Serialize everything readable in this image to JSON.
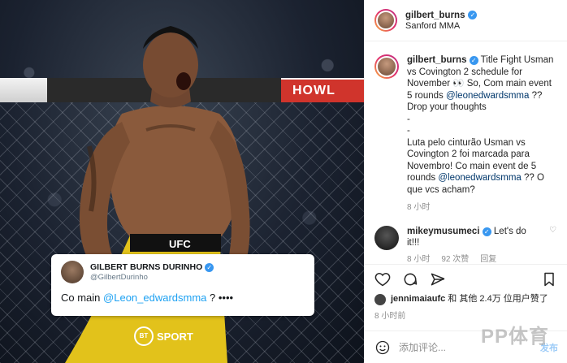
{
  "photo": {
    "banner_text": "HOWL",
    "tweet": {
      "name": "GILBERT BURNS DURINHO",
      "handle": "@GilbertDurinho",
      "text_prefix": "Co main ",
      "mention": "@Leon_edwardsmma",
      "text_suffix": " ? ••••"
    },
    "sport_logo": "SPORT",
    "sport_badge": "BT"
  },
  "header": {
    "username": "gilbert_burns",
    "location": "Sanford MMA"
  },
  "caption": {
    "username": "gilbert_burns",
    "text_1": " Title Fight Usman vs Covington 2 schedule for November 👀 So, Com main event 5 rounds ",
    "mention_1": "@leonedwardsmma",
    "text_2": " ?? Drop your thoughts",
    "text_3": "-",
    "text_4": "-",
    "text_5": "Luta pelo cinturão Usman vs Covington 2 foi marcada para Novembro! Co main event de 5 rounds ",
    "mention_2": "@leonedwardsmma",
    "text_6": " ?? O que vcs acham?",
    "time": "8 小时"
  },
  "comment": {
    "username": "mikeymusumeci",
    "text": " Let's do it!!!",
    "time": "8 小时",
    "likes": "92 次赞",
    "reply": "回复"
  },
  "likes_line": {
    "username": "jennimaiaufc",
    "text": " 和 其他 2.4万 位用户赞了"
  },
  "post_time": "8 小时前",
  "add_comment": {
    "placeholder": "添加评论...",
    "post_label": "发布"
  },
  "watermark": "PP体育"
}
